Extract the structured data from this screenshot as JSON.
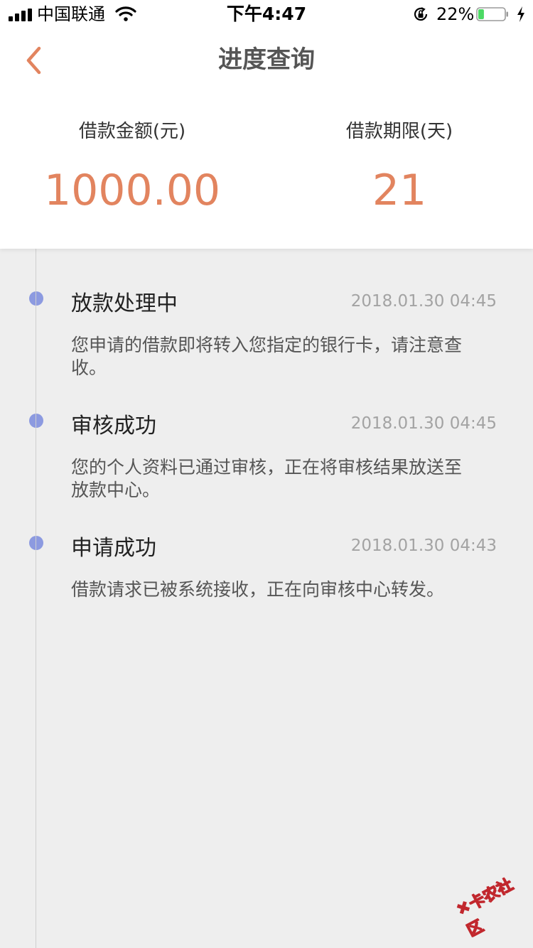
{
  "status_bar": {
    "carrier": "中国联通",
    "time": "下午4:47",
    "battery_percent": "22%",
    "battery_level": 0.22,
    "battery_color": "#4cd964"
  },
  "nav": {
    "title": "进度查询",
    "back_icon": "chevron-left-icon",
    "accent_color": "#e2845f"
  },
  "summary": {
    "amount_label": "借款金额(元)",
    "amount_value": "1000.00",
    "term_label": "借款期限(天)",
    "term_value": "21"
  },
  "timeline": {
    "dot_color": "#8c9ae0",
    "items": [
      {
        "title": "放款处理中",
        "time": "2018.01.30 04:45",
        "description": "您申请的借款即将转入您指定的银行卡，请注意查收。"
      },
      {
        "title": "审核成功",
        "time": "2018.01.30 04:45",
        "description": "您的个人资料已通过审核，正在将审核结果放送至放款中心。"
      },
      {
        "title": "申请成功",
        "time": "2018.01.30 04:43",
        "description": "借款请求已被系统接收，正在向审核中心转发。"
      }
    ]
  },
  "watermark": {
    "text": "卡农社区"
  }
}
